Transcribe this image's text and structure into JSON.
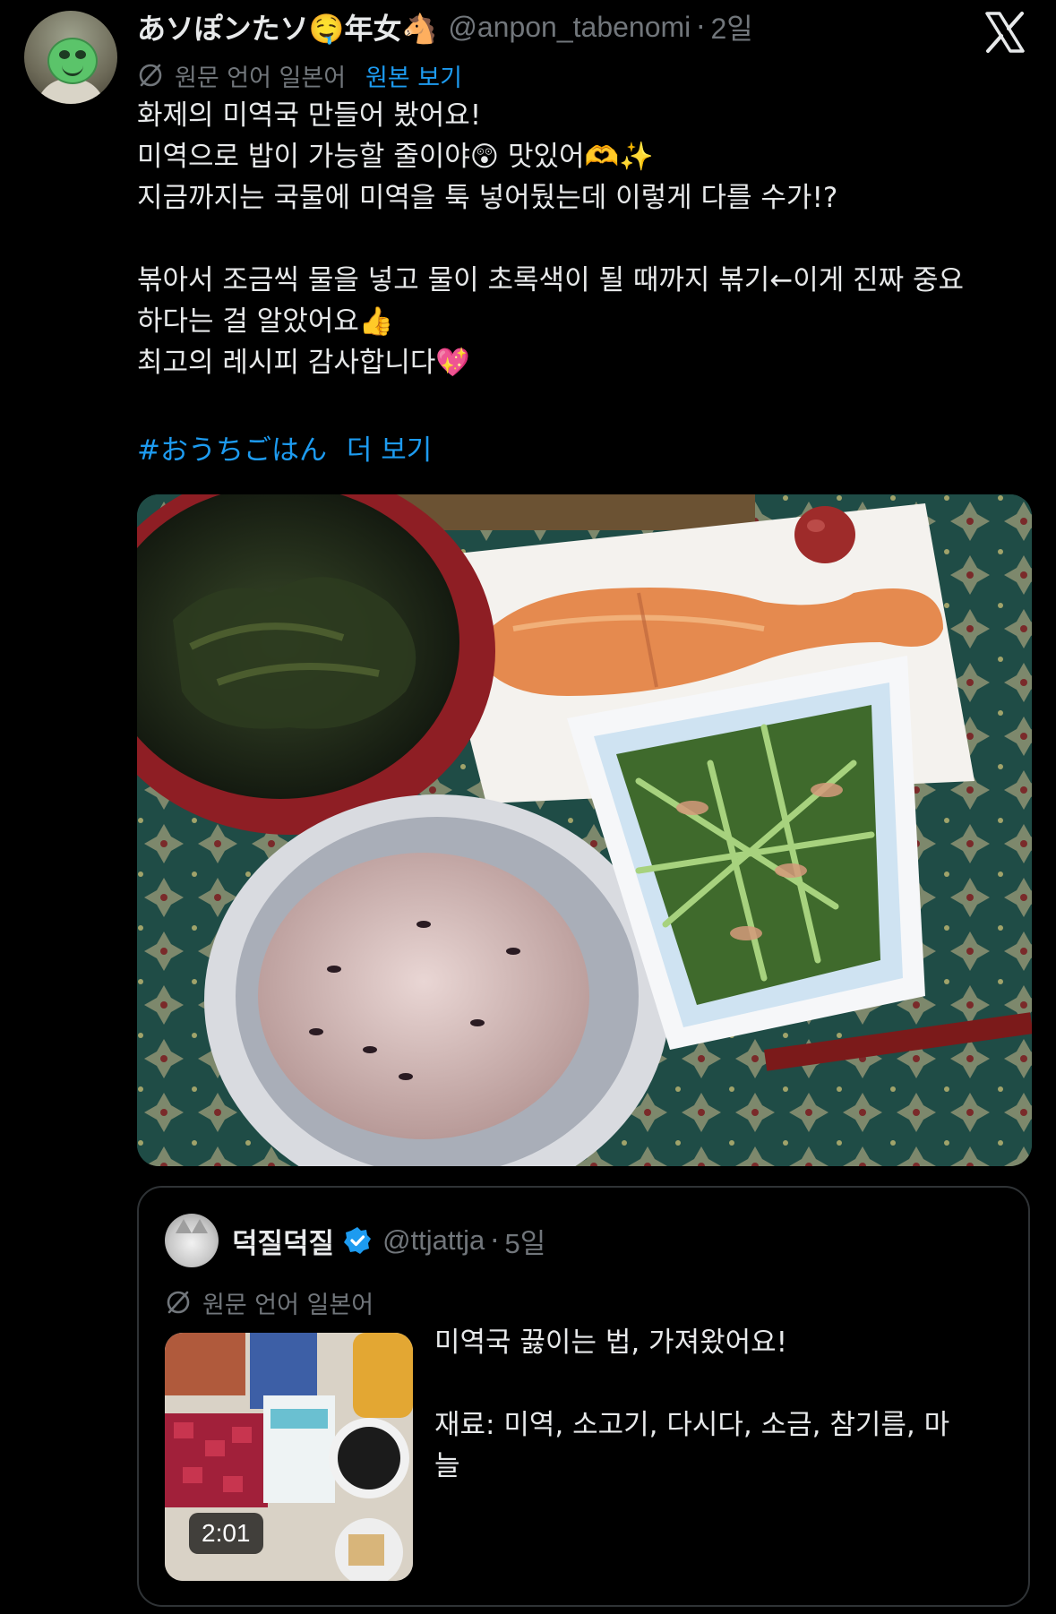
{
  "post": {
    "display_name": "あソぽンたソ🤤年女🐴",
    "handle": "@anpon_tabenomi",
    "separator": "·",
    "time": "2일",
    "translation": {
      "label": "원문 언어 일본어",
      "show_original": "원본 보기"
    },
    "body_lines": [
      "화제의 미역국 만들어 봤어요!",
      "미역으로 밥이 가능할 줄이야😲 맛있어🫶✨",
      "지금까지는 국물에 미역을 툭 넣어뒀는데 이렇게 다를 수가!?",
      "",
      "볶아서 조금씩 물을 넣고 물이 초록색이 될 때까지 볶기←이게 진짜 중요",
      "하다는 걸 알았어요👍",
      "최고의 레시피 감사합니다💖"
    ],
    "hashtag": "#おうちごはん",
    "more_label": "더 보기"
  },
  "quote": {
    "display_name": "덕질덕질",
    "handle": "@ttjattja",
    "separator": "·",
    "time": "5일",
    "translation_label": "원문 언어 일본어",
    "video_duration": "2:01",
    "text_lines": [
      "미역국 끓이는 법, 가져왔어요!",
      "",
      "재료: 미역, 소고기, 다시다, 소금, 참기름, 마",
      "늘"
    ]
  },
  "colors": {
    "background": "#000000",
    "text_primary": "#e7e9ea",
    "text_secondary": "#71767b",
    "accent": "#1d9bf0",
    "border": "#2f3336"
  },
  "icons": [
    "x-logo-icon",
    "translate-icon",
    "verified-badge-icon"
  ]
}
